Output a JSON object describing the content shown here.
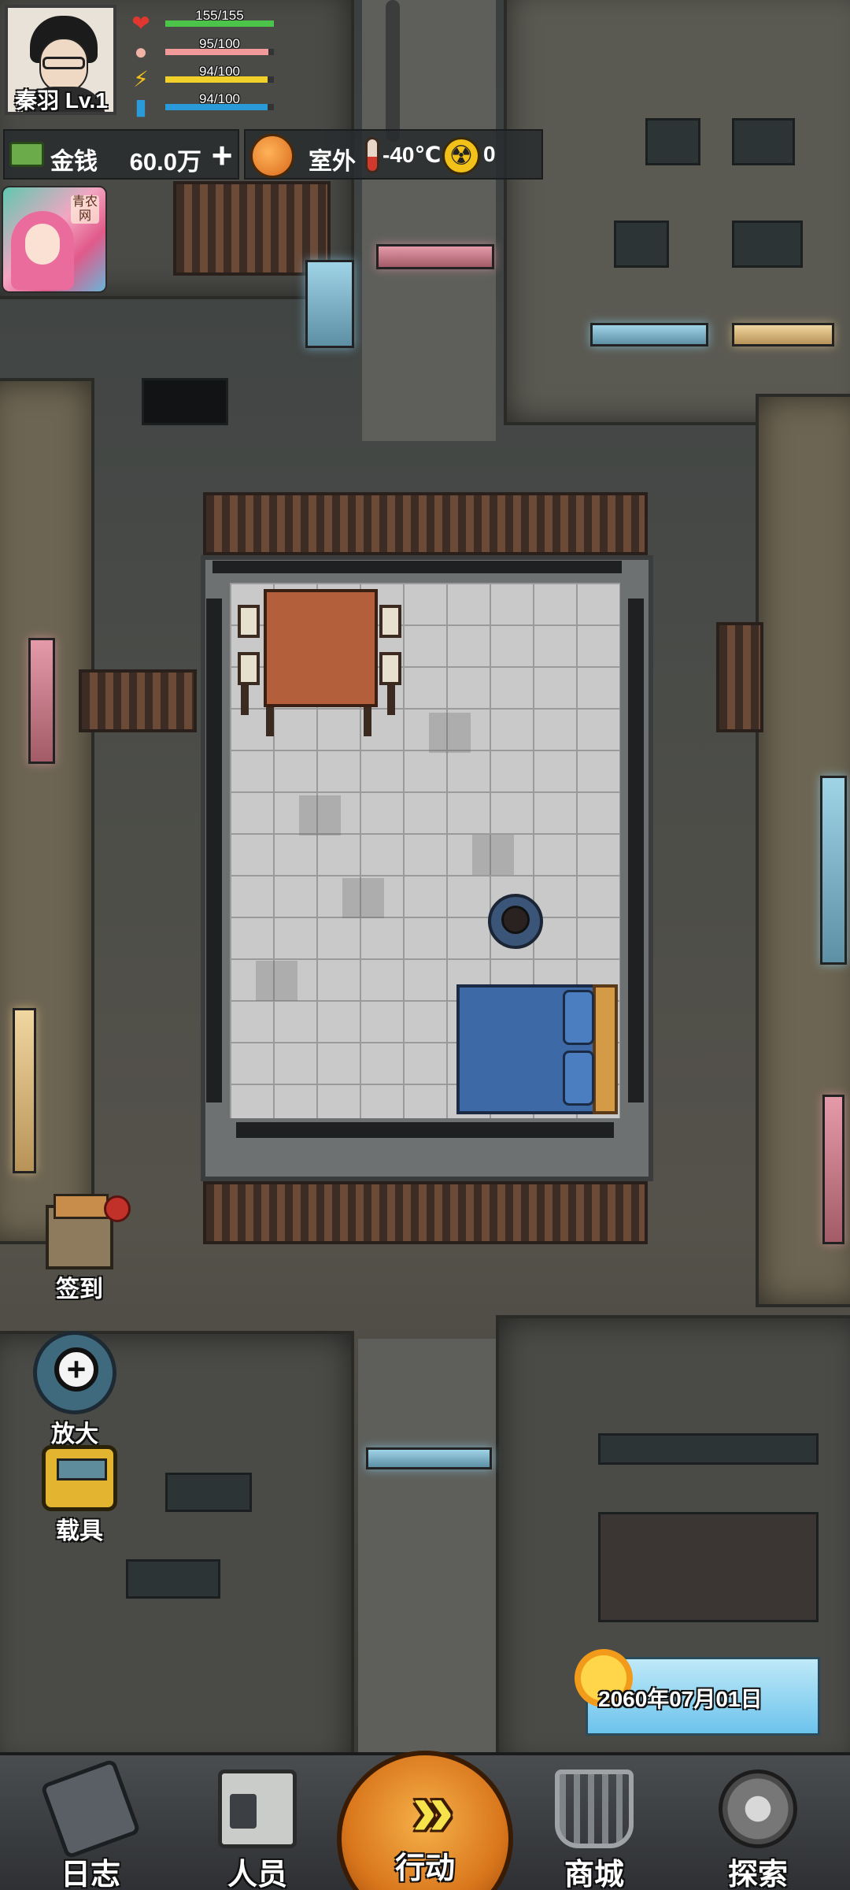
{
  "player": {
    "name": "秦羽 Lv.1",
    "stats": [
      {
        "icon": "heart-icon",
        "label": "155/155",
        "fraction": 1.0,
        "color": "#4cc44a"
      },
      {
        "icon": "stomach-icon",
        "label": "95/100",
        "fraction": 0.95,
        "color": "#f29a9a"
      },
      {
        "icon": "energy-icon",
        "label": "94/100",
        "fraction": 0.94,
        "color": "#f2d02a"
      },
      {
        "icon": "water-icon",
        "label": "94/100",
        "fraction": 0.94,
        "color": "#2a9ad8"
      }
    ]
  },
  "money": {
    "label": "金钱",
    "value": "60.0万",
    "add": "+"
  },
  "environment": {
    "location": "室外",
    "temperature": "-40℃",
    "radiation": "0"
  },
  "promo": {
    "label": "青农网"
  },
  "side_buttons": {
    "signin": "签到",
    "zoom": "放大",
    "vehicle": "载具"
  },
  "date": "2060年07月01日",
  "nav": {
    "log": "日志",
    "staff": "人员",
    "action": "行动",
    "shop": "商城",
    "explore": "探索"
  },
  "colors": {
    "accent": "#d9761c",
    "hud_bg": "#282c2e"
  }
}
